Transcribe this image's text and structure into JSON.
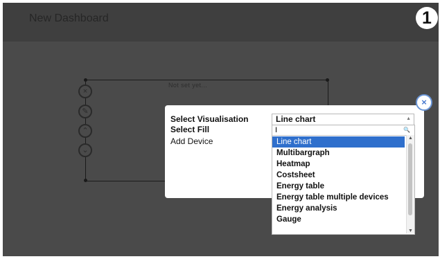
{
  "step_number": "1",
  "dashboard": {
    "title": "New Dashboard",
    "widget_title": "Not set yet..."
  },
  "widget_controls": {
    "close": "×",
    "edit": "✎",
    "move_up": "⌃",
    "move_down": "⌄"
  },
  "modal": {
    "close_icon": "×",
    "select_visualisation_label": "Select Visualisation",
    "select_fill_label": "Select Fill",
    "add_device_label": "Add Device",
    "selected_value": "Line chart",
    "search_value": "I",
    "options": [
      "Line chart",
      "Multibargraph",
      "Heatmap",
      "Costsheet",
      "Energy table",
      "Energy table multiple devices",
      "Energy analysis",
      "Gauge"
    ],
    "highlighted_index": 0
  },
  "colors": {
    "overlay": "#4a4a4a",
    "header": "#3f3f3f",
    "highlight": "#2f6fcc",
    "close_ring": "#6a95d6"
  },
  "icons": {
    "select_arrow": "▲",
    "search": "magnifier-icon"
  }
}
